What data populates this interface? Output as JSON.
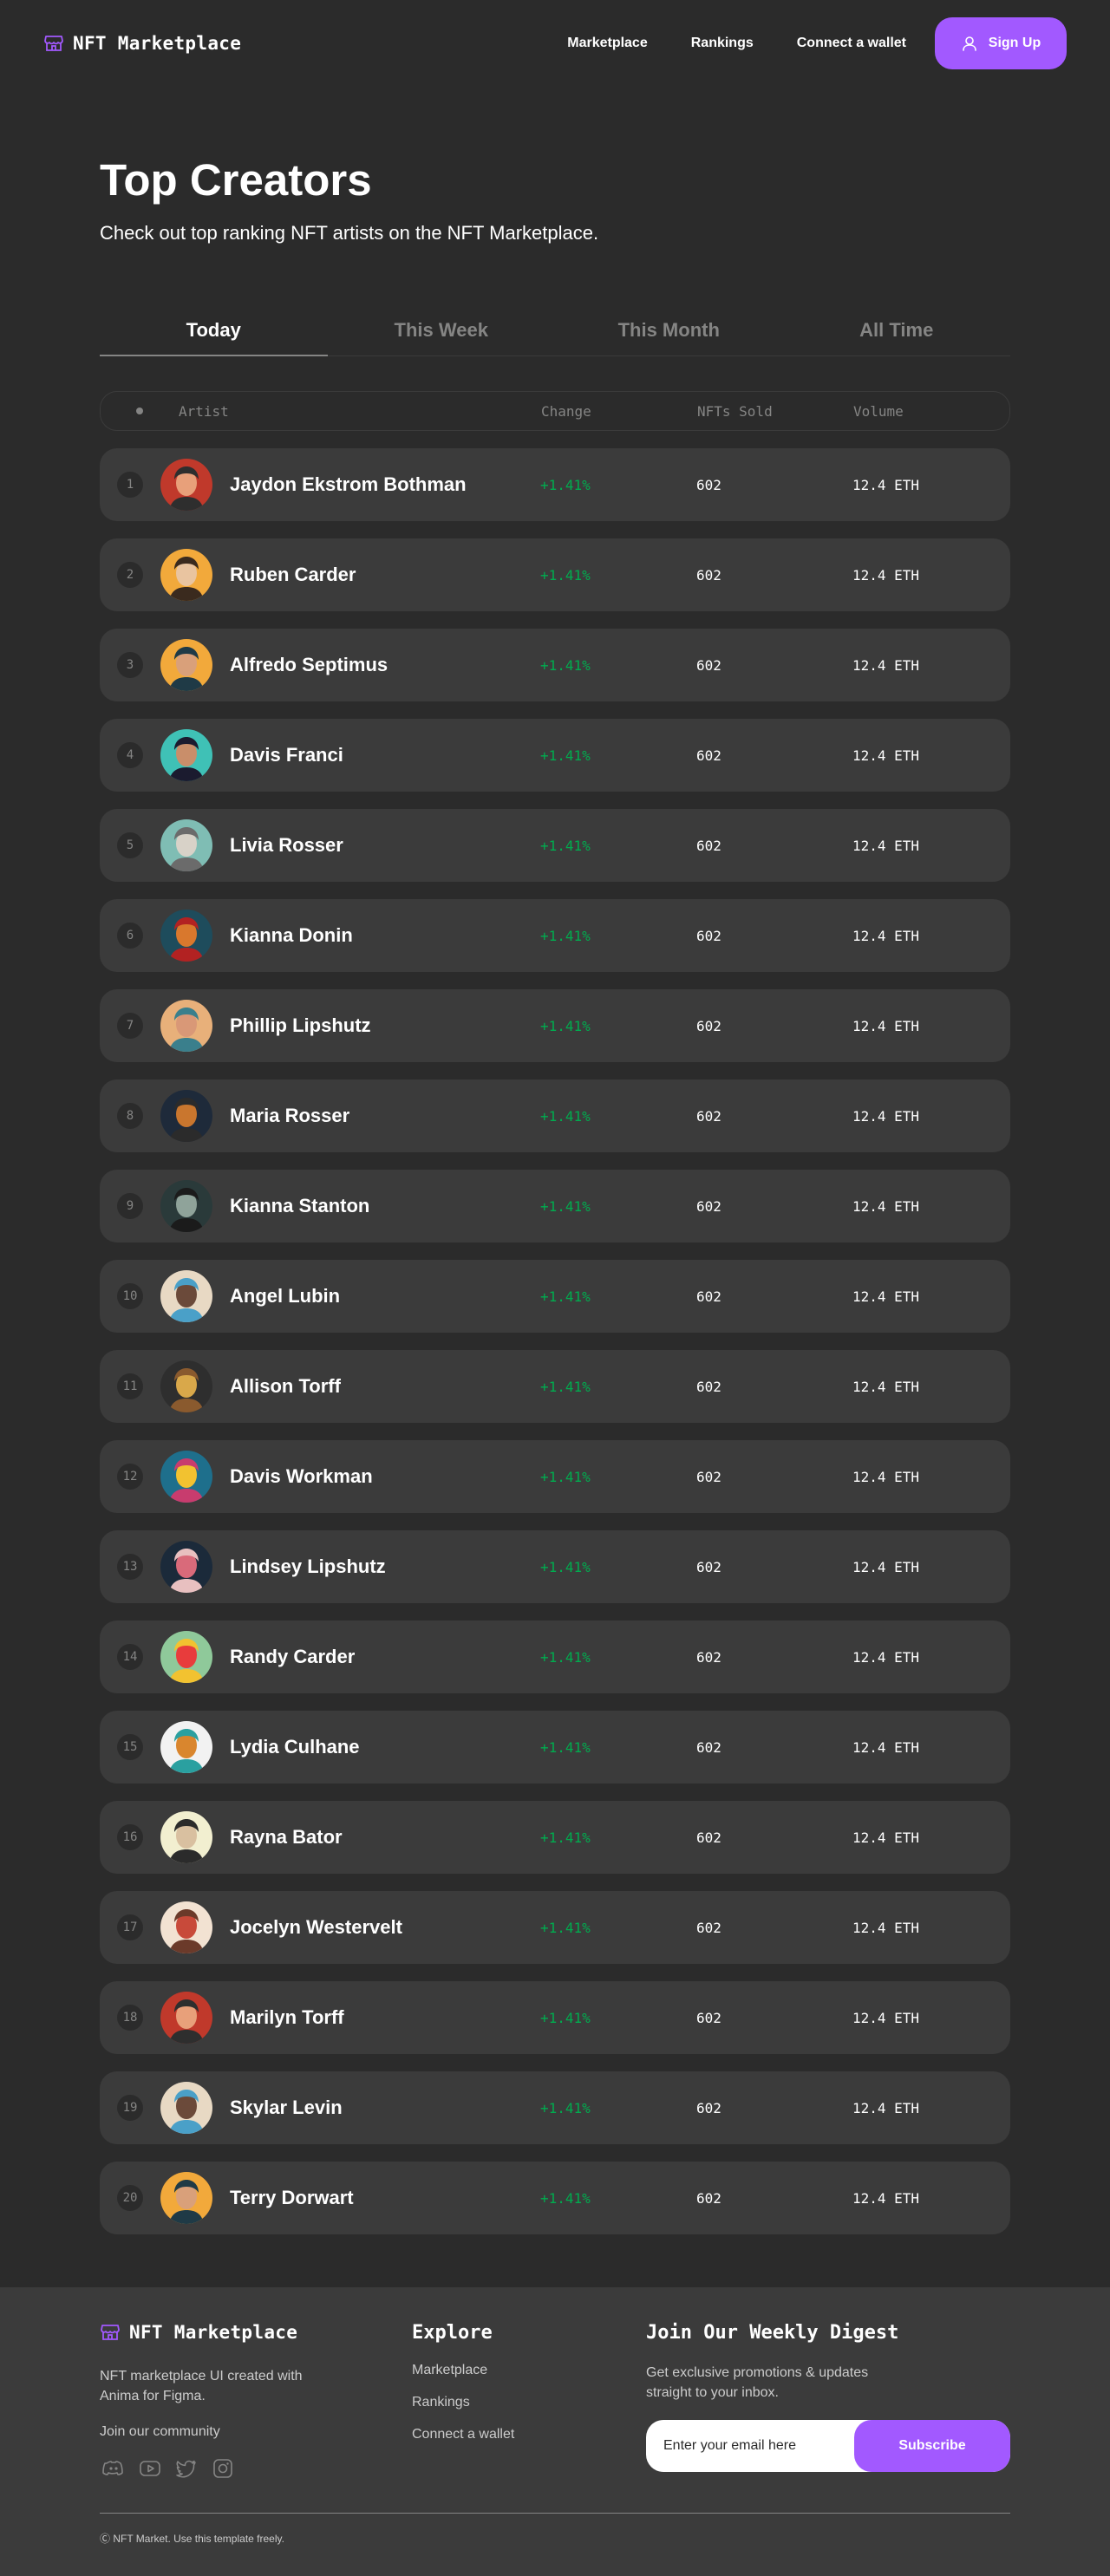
{
  "nav": {
    "brand": "NFT Marketplace",
    "links": [
      "Marketplace",
      "Rankings",
      "Connect a wallet"
    ],
    "signup_label": "Sign Up"
  },
  "hero": {
    "title": "Top Creators",
    "subtitle": "Check out top ranking NFT artists on the NFT Marketplace."
  },
  "tabs": [
    {
      "label": "Today",
      "active": true
    },
    {
      "label": "This Week",
      "active": false
    },
    {
      "label": "This Month",
      "active": false
    },
    {
      "label": "All Time",
      "active": false
    }
  ],
  "table": {
    "headers": {
      "artist": "Artist",
      "change": "Change",
      "sold": "NFTs Sold",
      "volume": "Volume"
    },
    "rows": [
      {
        "rank": "1",
        "name": "Jaydon Ekstrom Bothman",
        "change": "+1.41%",
        "sold": "602",
        "volume": "12.4 ETH",
        "avatar_colors": [
          "#C0392B",
          "#E8A07A",
          "#2E2E2E"
        ]
      },
      {
        "rank": "2",
        "name": "Ruben Carder",
        "change": "+1.41%",
        "sold": "602",
        "volume": "12.4 ETH",
        "avatar_colors": [
          "#F2A93B",
          "#E9C4A0",
          "#3A2A1E"
        ]
      },
      {
        "rank": "3",
        "name": "Alfredo Septimus",
        "change": "+1.41%",
        "sold": "602",
        "volume": "12.4 ETH",
        "avatar_colors": [
          "#F2A93B",
          "#D9A07A",
          "#1F3A46"
        ]
      },
      {
        "rank": "4",
        "name": "Davis Franci",
        "change": "+1.41%",
        "sold": "602",
        "volume": "12.4 ETH",
        "avatar_colors": [
          "#3FC1B6",
          "#C98E6A",
          "#1B1B2F"
        ]
      },
      {
        "rank": "5",
        "name": "Livia Rosser",
        "change": "+1.41%",
        "sold": "602",
        "volume": "12.4 ETH",
        "avatar_colors": [
          "#7FBDB4",
          "#D8D2C8",
          "#6B6B6B"
        ]
      },
      {
        "rank": "6",
        "name": "Kianna Donin",
        "change": "+1.41%",
        "sold": "602",
        "volume": "12.4 ETH",
        "avatar_colors": [
          "#1E4C5C",
          "#D9782D",
          "#B22222"
        ]
      },
      {
        "rank": "7",
        "name": "Phillip Lipshutz",
        "change": "+1.41%",
        "sold": "602",
        "volume": "12.4 ETH",
        "avatar_colors": [
          "#E8B07A",
          "#D99877",
          "#3A7F8C"
        ]
      },
      {
        "rank": "8",
        "name": "Maria Rosser",
        "change": "+1.41%",
        "sold": "602",
        "volume": "12.4 ETH",
        "avatar_colors": [
          "#1E2A3A",
          "#C9762E",
          "#2B2B2B"
        ]
      },
      {
        "rank": "9",
        "name": "Kianna Stanton",
        "change": "+1.41%",
        "sold": "602",
        "volume": "12.4 ETH",
        "avatar_colors": [
          "#2A3A3A",
          "#8FA39A",
          "#1B1B1B"
        ]
      },
      {
        "rank": "10",
        "name": "Angel Lubin",
        "change": "+1.41%",
        "sold": "602",
        "volume": "12.4 ETH",
        "avatar_colors": [
          "#E8D9C4",
          "#6B4A3A",
          "#4AA0C8"
        ]
      },
      {
        "rank": "11",
        "name": "Allison Torff",
        "change": "+1.41%",
        "sold": "602",
        "volume": "12.4 ETH",
        "avatar_colors": [
          "#2E2E2E",
          "#D9A84A",
          "#8A5A2E"
        ]
      },
      {
        "rank": "12",
        "name": "Davis Workman",
        "change": "+1.41%",
        "sold": "602",
        "volume": "12.4 ETH",
        "avatar_colors": [
          "#1E6F8C",
          "#F2C230",
          "#C83C6E"
        ]
      },
      {
        "rank": "13",
        "name": "Lindsey Lipshutz",
        "change": "+1.41%",
        "sold": "602",
        "volume": "12.4 ETH",
        "avatar_colors": [
          "#1B2A3A",
          "#D96A7A",
          "#E8C0C0"
        ]
      },
      {
        "rank": "14",
        "name": "Randy Carder",
        "change": "+1.41%",
        "sold": "602",
        "volume": "12.4 ETH",
        "avatar_colors": [
          "#8FC99A",
          "#E83C3C",
          "#F2C230"
        ]
      },
      {
        "rank": "15",
        "name": "Lydia Culhane",
        "change": "+1.41%",
        "sold": "602",
        "volume": "12.4 ETH",
        "avatar_colors": [
          "#F2F2F2",
          "#D9862E",
          "#2AA0A0"
        ]
      },
      {
        "rank": "16",
        "name": "Rayna Bator",
        "change": "+1.41%",
        "sold": "602",
        "volume": "12.4 ETH",
        "avatar_colors": [
          "#F2EFD0",
          "#D9C0A0",
          "#2B2B2B"
        ]
      },
      {
        "rank": "17",
        "name": "Jocelyn Westervelt",
        "change": "+1.41%",
        "sold": "602",
        "volume": "12.4 ETH",
        "avatar_colors": [
          "#F2E2D2",
          "#C84A3A",
          "#6B3A2A"
        ]
      },
      {
        "rank": "18",
        "name": "Marilyn Torff",
        "change": "+1.41%",
        "sold": "602",
        "volume": "12.4 ETH",
        "avatar_colors": [
          "#C0392B",
          "#E8A07A",
          "#2E2E2E"
        ]
      },
      {
        "rank": "19",
        "name": "Skylar Levin",
        "change": "+1.41%",
        "sold": "602",
        "volume": "12.4 ETH",
        "avatar_colors": [
          "#E8D9C4",
          "#6B4A3A",
          "#4AA0C8"
        ]
      },
      {
        "rank": "20",
        "name": "Terry Dorwart",
        "change": "+1.41%",
        "sold": "602",
        "volume": "12.4 ETH",
        "avatar_colors": [
          "#F2A93B",
          "#D9A07A",
          "#1F3A46"
        ]
      }
    ]
  },
  "footer": {
    "brand": "NFT Marketplace",
    "description": "NFT marketplace UI created with Anima for Figma.",
    "community_label": "Join our community",
    "socials": [
      "discord-icon",
      "youtube-icon",
      "twitter-icon",
      "instagram-icon"
    ],
    "explore_heading": "Explore",
    "explore_links": [
      "Marketplace",
      "Rankings",
      "Connect a wallet"
    ],
    "digest_heading": "Join Our Weekly Digest",
    "digest_text": "Get exclusive promotions & updates straight to your inbox.",
    "email_placeholder": "Enter your email here",
    "subscribe_label": "Subscribe",
    "copyright": "Ⓒ NFT Market. Use this template freely."
  },
  "colors": {
    "background": "#2B2B2B",
    "surface": "#3B3B3B",
    "accent": "#A259FF",
    "positive": "#00AC4F",
    "muted": "#858584"
  }
}
